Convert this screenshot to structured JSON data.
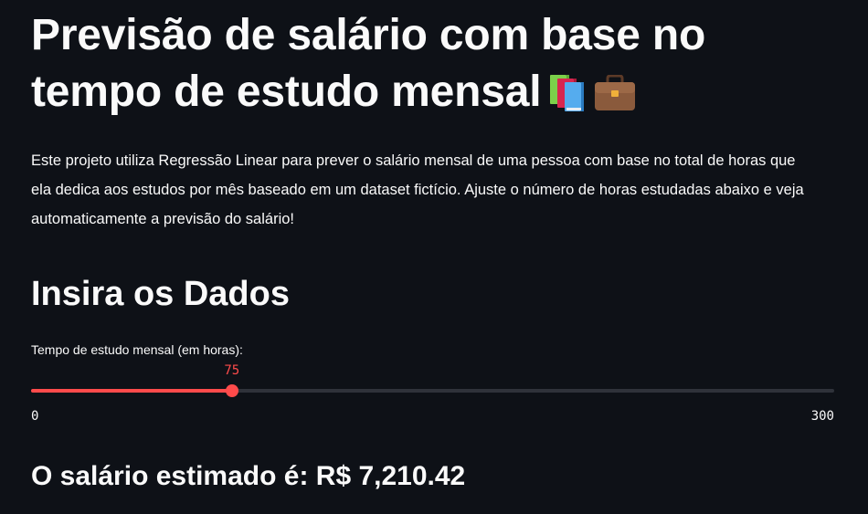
{
  "title": "Previsão de salário com base no tempo de estudo mensal",
  "title_icons": [
    "books-icon",
    "briefcase-icon"
  ],
  "description": "Este projeto utiliza Regressão Linear para prever o salário mensal de uma pessoa com base no total de horas que ela dedica aos estudos por mês baseado em um dataset fictício. Ajuste o número de horas estudadas abaixo e veja automaticamente a previsão do salário!",
  "section_title": "Insira os Dados",
  "slider": {
    "label": "Tempo de estudo mensal (em horas):",
    "value": 75,
    "min": 0,
    "max": 300,
    "value_text": "75",
    "min_text": "0",
    "max_text": "300"
  },
  "result_text": "O salário estimado é: R$ 7,210.42",
  "colors": {
    "background": "#0e1117",
    "text": "#fafafa",
    "accent": "#ff4b4b",
    "track": "#2f323a"
  }
}
